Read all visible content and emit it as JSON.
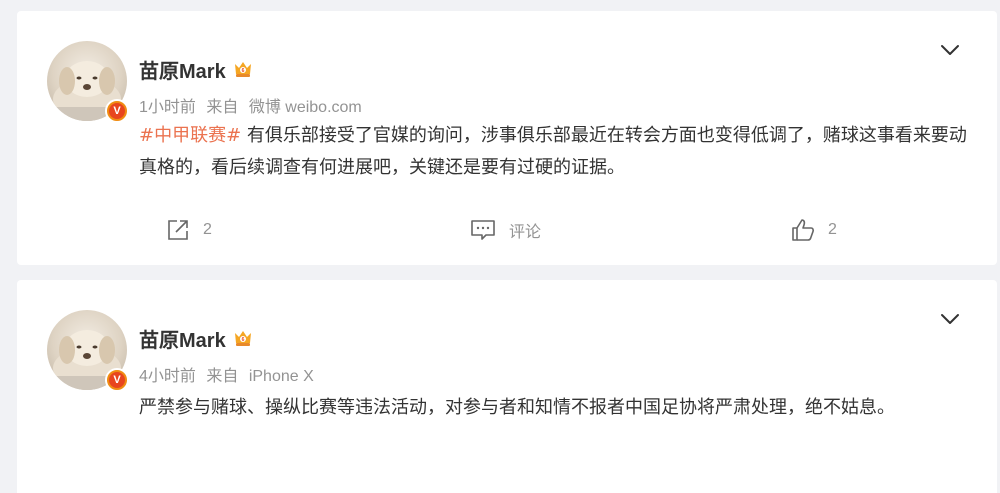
{
  "posts": [
    {
      "username": "苗原Mark",
      "time": "1小时前",
      "source_prefix": "来自",
      "source": "微博 weibo.com",
      "hashtag": "#中甲联赛#",
      "text": " 有俱乐部接受了官媒的询问，涉事俱乐部最近在转会方面也变得低调了，赌球这事看来要动真格的，看后续调查有何进展吧，关键还是要有过硬的证据。",
      "forward_count": "2",
      "comment_label": "评论",
      "like_count": "2"
    },
    {
      "username": "苗原Mark",
      "time": "4小时前",
      "source_prefix": "来自",
      "source": "iPhone X",
      "text": "严禁参与赌球、操纵比赛等违法活动，对参与者和知情不报者中国足协将严肃处理，绝不姑息。"
    }
  ],
  "icons": {
    "verified_badge": "V",
    "crown": "vip-crown-icon",
    "chevron": "chevron-down-icon",
    "forward": "forward-icon",
    "comment": "comment-icon",
    "like": "thumbs-up-icon"
  },
  "colors": {
    "background": "#f1f2f5",
    "hashtag": "#eb7350",
    "meta": "#939393",
    "badge": "#f08c12"
  }
}
